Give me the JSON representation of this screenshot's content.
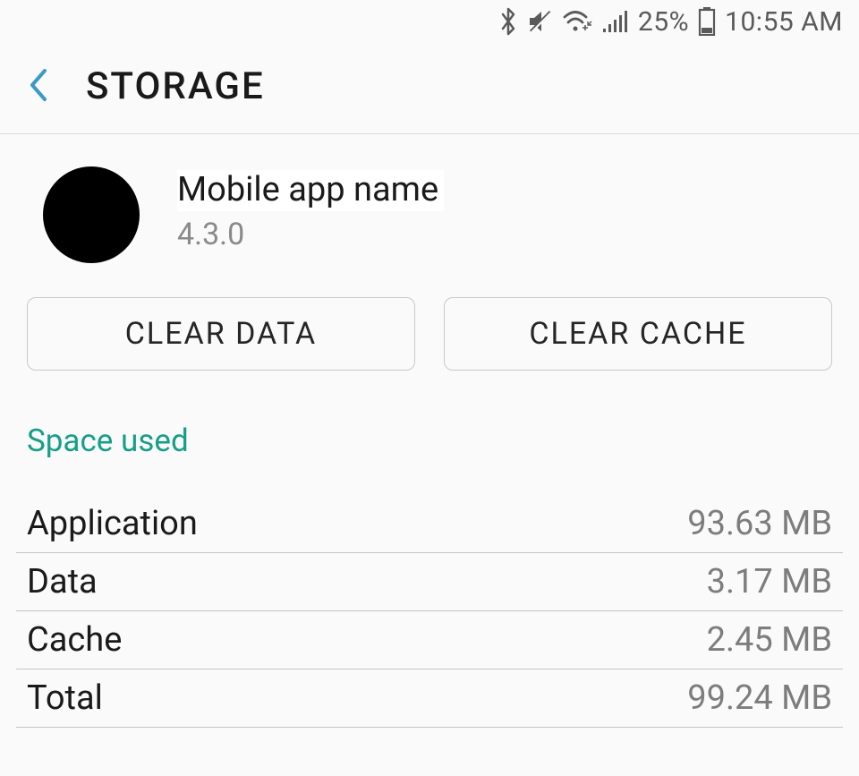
{
  "status_bar": {
    "battery_percent": "25%",
    "time": "10:55 AM"
  },
  "header": {
    "title": "STORAGE"
  },
  "app": {
    "name": "Mobile app name",
    "version": "4.3.0"
  },
  "buttons": {
    "clear_data": "CLEAR DATA",
    "clear_cache": "CLEAR CACHE"
  },
  "section": {
    "title": "Space used"
  },
  "space": {
    "rows": [
      {
        "label": "Application",
        "value": "93.63 MB"
      },
      {
        "label": "Data",
        "value": "3.17 MB"
      },
      {
        "label": "Cache",
        "value": "2.45 MB"
      },
      {
        "label": "Total",
        "value": "99.24 MB"
      }
    ]
  }
}
